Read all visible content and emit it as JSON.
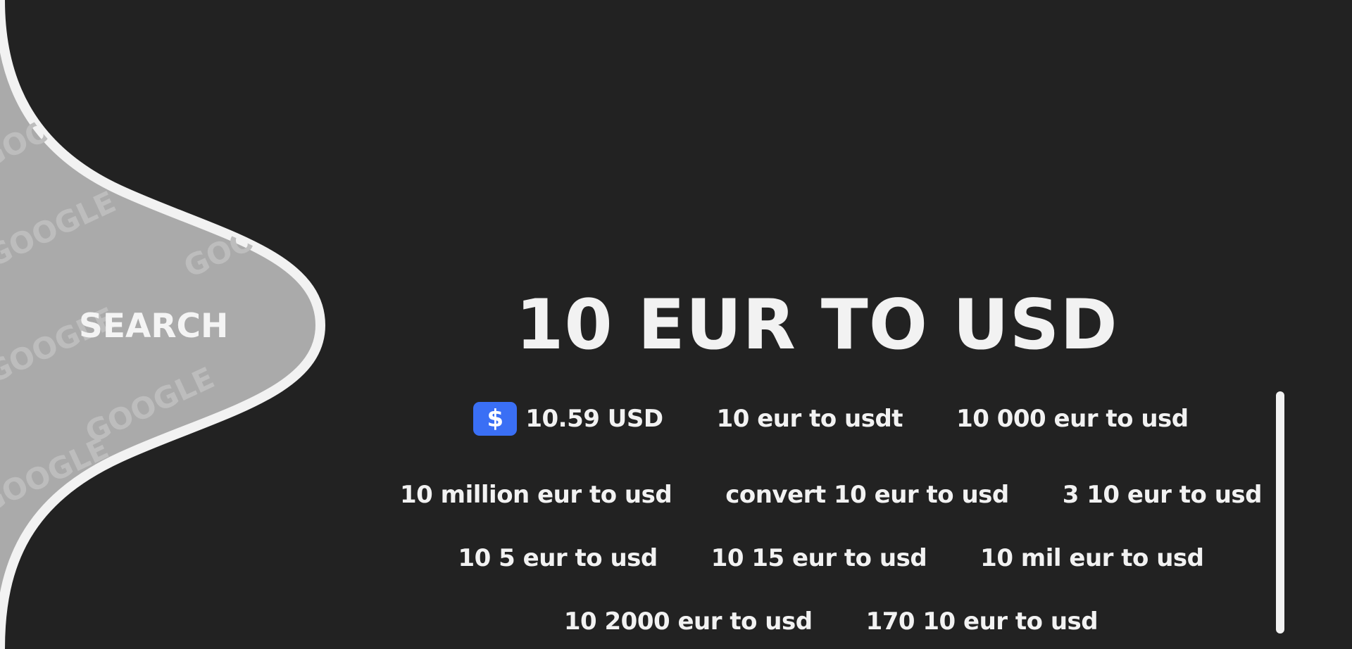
{
  "search": {
    "label": "SEARCH",
    "watermark": "GOOGLE"
  },
  "title": "10 EUR TO USD",
  "result": {
    "icon": "dollar-icon",
    "icon_glyph": "$",
    "text": "10.59 USD"
  },
  "links": {
    "row1": [
      "10 eur to usdt",
      "10 000 eur to usd"
    ],
    "row2": [
      "10 million eur to usd",
      "convert 10 eur to usd",
      "3 10 eur to usd"
    ],
    "row3": [
      "10 5 eur to usd",
      "10 15 eur to usd",
      "10 mil eur to usd"
    ],
    "row4": [
      "10 2000 eur to usd",
      "170 10 eur to usd"
    ]
  },
  "colors": {
    "background": "#222222",
    "bulge_fill": "#aaaaaa",
    "bulge_border": "#f2f2f2",
    "text": "#f2f2f2",
    "accent": "#3a6ff5"
  }
}
